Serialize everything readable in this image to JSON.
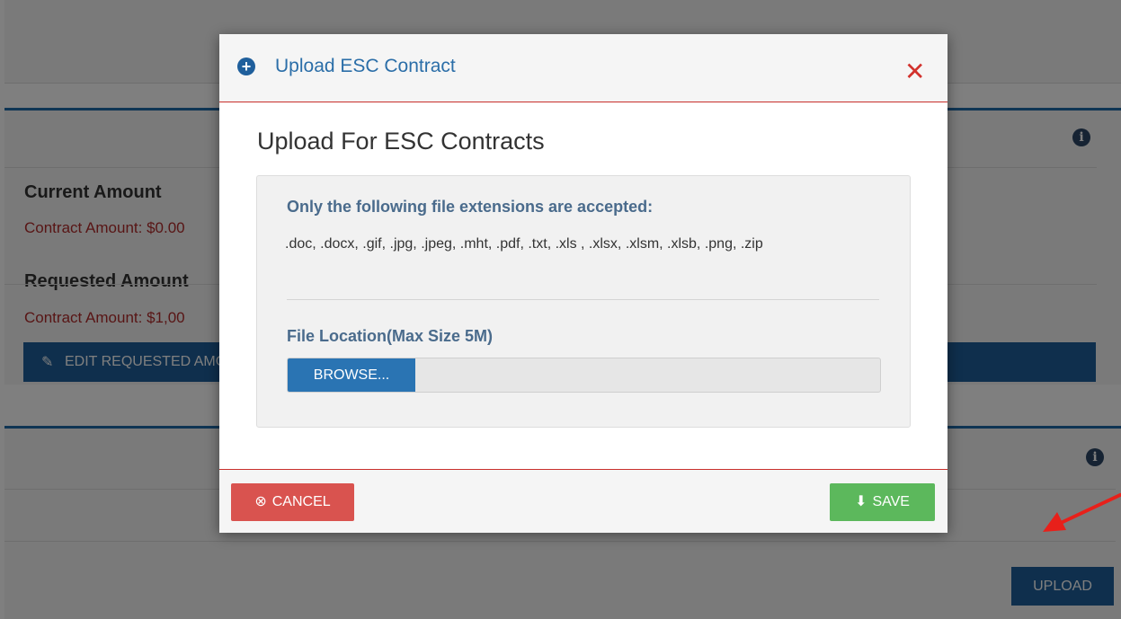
{
  "background": {
    "current_amount_heading": "Current Amount",
    "current_contract_amount": "Contract Amount: $0.00",
    "requested_amount_heading": "Requested Amount",
    "requested_contract_amount": "Contract Amount: $1,00",
    "edit_requested_button": "EDIT REQUESTED AMOUNT",
    "upload_button": "UPLOAD",
    "info_icon_glyph": "i"
  },
  "modal": {
    "header_icon_glyph": "+",
    "title": "Upload ESC Contract",
    "close_glyph": "✕",
    "heading": "Upload For ESC Contracts",
    "accepted_title": "Only the following file extensions are accepted:",
    "accepted_extensions": ".doc, .docx, .gif, .jpg, .jpeg, .mht, .pdf, .txt, .xls , .xlsx, .xlsm, .xlsb, .png, .zip",
    "file_location_label": "File Location(Max Size 5M)",
    "browse_label": "BROWSE...",
    "cancel_label": "CANCEL",
    "cancel_icon_glyph": "⊗",
    "save_label": "SAVE",
    "save_icon_glyph": "⬇"
  },
  "colors": {
    "title_blue": "#2b6ea8",
    "danger": "#d9534f",
    "success": "#5cb85c",
    "primary": "#2a74b3",
    "annotation_arrow": "#e8201a"
  },
  "icons": [
    "plus-circle-icon",
    "close-icon",
    "info-icon",
    "cancel-icon",
    "save-icon",
    "edit-icon",
    "arrow-annotation"
  ]
}
